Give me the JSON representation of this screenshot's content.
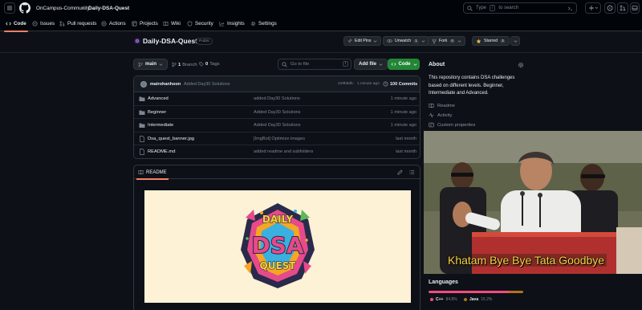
{
  "header": {
    "owner": "OnCampus-Community",
    "separator": "/",
    "repo": "Daily-DSA-Quest",
    "search_placeholder_pre": "Type",
    "search_key": "/",
    "search_placeholder_post": "to search"
  },
  "repo_nav": [
    {
      "label": "Code",
      "icon": "code-icon"
    },
    {
      "label": "Issues",
      "icon": "issue-icon"
    },
    {
      "label": "Pull requests",
      "icon": "pull-request-icon"
    },
    {
      "label": "Actions",
      "icon": "play-icon"
    },
    {
      "label": "Projects",
      "icon": "table-icon"
    },
    {
      "label": "Wiki",
      "icon": "book-icon"
    },
    {
      "label": "Security",
      "icon": "shield-icon"
    },
    {
      "label": "Insights",
      "icon": "graph-icon"
    },
    {
      "label": "Settings",
      "icon": "gear-icon"
    }
  ],
  "repo": {
    "name": "Daily-DSA-Quest",
    "visibility": "Public",
    "edit_pins": "Edit Pins",
    "unwatch": "Unwatch",
    "watch_count": "1",
    "fork": "Fork",
    "fork_count": "0",
    "starred": "Starred",
    "star_count": "3"
  },
  "controls": {
    "branch": "main",
    "branches_count": "1",
    "branches_label": "Branch",
    "tags_count": "0",
    "tags_label": "Tags",
    "go_to_file": "Go to file",
    "go_key": "t",
    "add_file": "Add file",
    "code": "Code"
  },
  "commit": {
    "author": "mairohanhoon",
    "message": "Added Day30 Solutions",
    "hash": "229b8db",
    "sep": "·",
    "time": "1 minute ago",
    "count": "100 Commits"
  },
  "files": [
    {
      "name": "Advanced",
      "type": "folder",
      "message": "added Day30 Solutions",
      "time": "1 minute ago"
    },
    {
      "name": "Beginner",
      "type": "folder",
      "message": "Added Day30 Solutions",
      "time": "1 minute ago"
    },
    {
      "name": "Intermediate",
      "type": "folder",
      "message": "Added Day30 Solutions",
      "time": "1 minute ago"
    },
    {
      "name": "Dsa_quest_banner.jpg",
      "type": "file",
      "message": "[ImgBot] Optimize images",
      "time": "last month"
    },
    {
      "name": "README.md",
      "type": "file",
      "message": "added readme and subfolders",
      "time": "last month"
    }
  ],
  "readme": {
    "tab": "README",
    "banner_line1": "DAILY",
    "banner_line2": "DSA",
    "banner_line3": "QUEST"
  },
  "sidebar": {
    "about_title": "About",
    "description": "This repository contains DSA challenges based on different levels. Beginner, Intermediate and Advanced.",
    "links": [
      "Readme",
      "Activity",
      "Custom properties"
    ],
    "video_caption": "Khatam Bye Bye Tata Goodbye",
    "languages_title": "Languages",
    "languages": [
      {
        "name": "C++",
        "percent": "84.8%",
        "value": 84.8,
        "color": "#f34b7d"
      },
      {
        "name": "Java",
        "percent": "15.2%",
        "value": 15.2,
        "color": "#b07219"
      }
    ]
  },
  "colors": {
    "accent_tab": "#f78166",
    "code_button": "#238636",
    "background": "#0d1117",
    "header": "#010409"
  }
}
